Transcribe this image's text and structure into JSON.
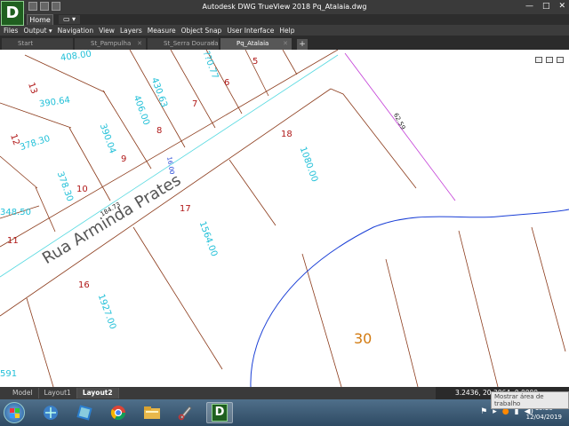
{
  "title_bar": {
    "app_logo": "D",
    "window_title": "Autodesk DWG TrueView 2018    Pq_Atalaia.dwg",
    "controls": [
      "—",
      "□",
      "✕"
    ]
  },
  "ribbon": {
    "home_tab": "Home",
    "extra_tab": "▭ ▾"
  },
  "menu": {
    "items": [
      "Files",
      "Output ▾",
      "Navigation",
      "View",
      "Layers",
      "Measure",
      "Object Snap",
      "User Interface",
      "Help"
    ]
  },
  "doc_tabs": {
    "tabs": [
      {
        "label": "Start",
        "active": false
      },
      {
        "label": "St_Pampulha",
        "active": false
      },
      {
        "label": "St_Serra Dourada",
        "active": false
      },
      {
        "label": "Pq_Atalaia",
        "active": true
      }
    ],
    "close_glyph": "✕",
    "new_tab": "+"
  },
  "drawing": {
    "street_name": "Rua Arminda Prates",
    "dims": {
      "d_408": "408.00",
      "d_430": "430.63",
      "d_406": "406.00",
      "d_390_64": "390.64",
      "d_390_04": "390.04",
      "d_378_30a": "378.30",
      "d_378_30b": "378.30",
      "d_348_50": "348.50",
      "d_1080": "1080.00",
      "d_1564": "1564.00",
      "d_1927": "1927.00",
      "d_1xx_77": "??0.77",
      "d_62_59": "62.59",
      "d_184_73": "184.73",
      "d_16_00": "16.00",
      "d_591": "591"
    },
    "lots": {
      "l5": "5",
      "l6": "6",
      "l7": "7",
      "l8": "8",
      "l9": "9",
      "l10": "10",
      "l11": "11",
      "l12": "12",
      "l13": "13",
      "l16": "16",
      "l17": "17",
      "l18": "18"
    },
    "big_lot": "30"
  },
  "layout_tabs": {
    "tabs": [
      "Model",
      "Layout1",
      "Layout2"
    ],
    "active": "Layout2"
  },
  "status": {
    "coords": "3.2436, 20.3064, 0.0000",
    "tooltip": "Mostrar área de trabalho"
  },
  "taskbar": {
    "apps": [
      "windows-explorer",
      "media-player",
      "chrome",
      "file-explorer",
      "snipping-tool",
      "dwg-trueview"
    ],
    "time": "15:25",
    "date": "12/04/2019"
  },
  "colors": {
    "lot_line": "#8b3a1a",
    "offset_line": "#55d9e0",
    "boundary": "#1a3fd6",
    "right_line": "#c23ad6",
    "dim_text": "#22c0d8",
    "lot_number": "#b01818",
    "big_lot_number": "#d27a10"
  }
}
